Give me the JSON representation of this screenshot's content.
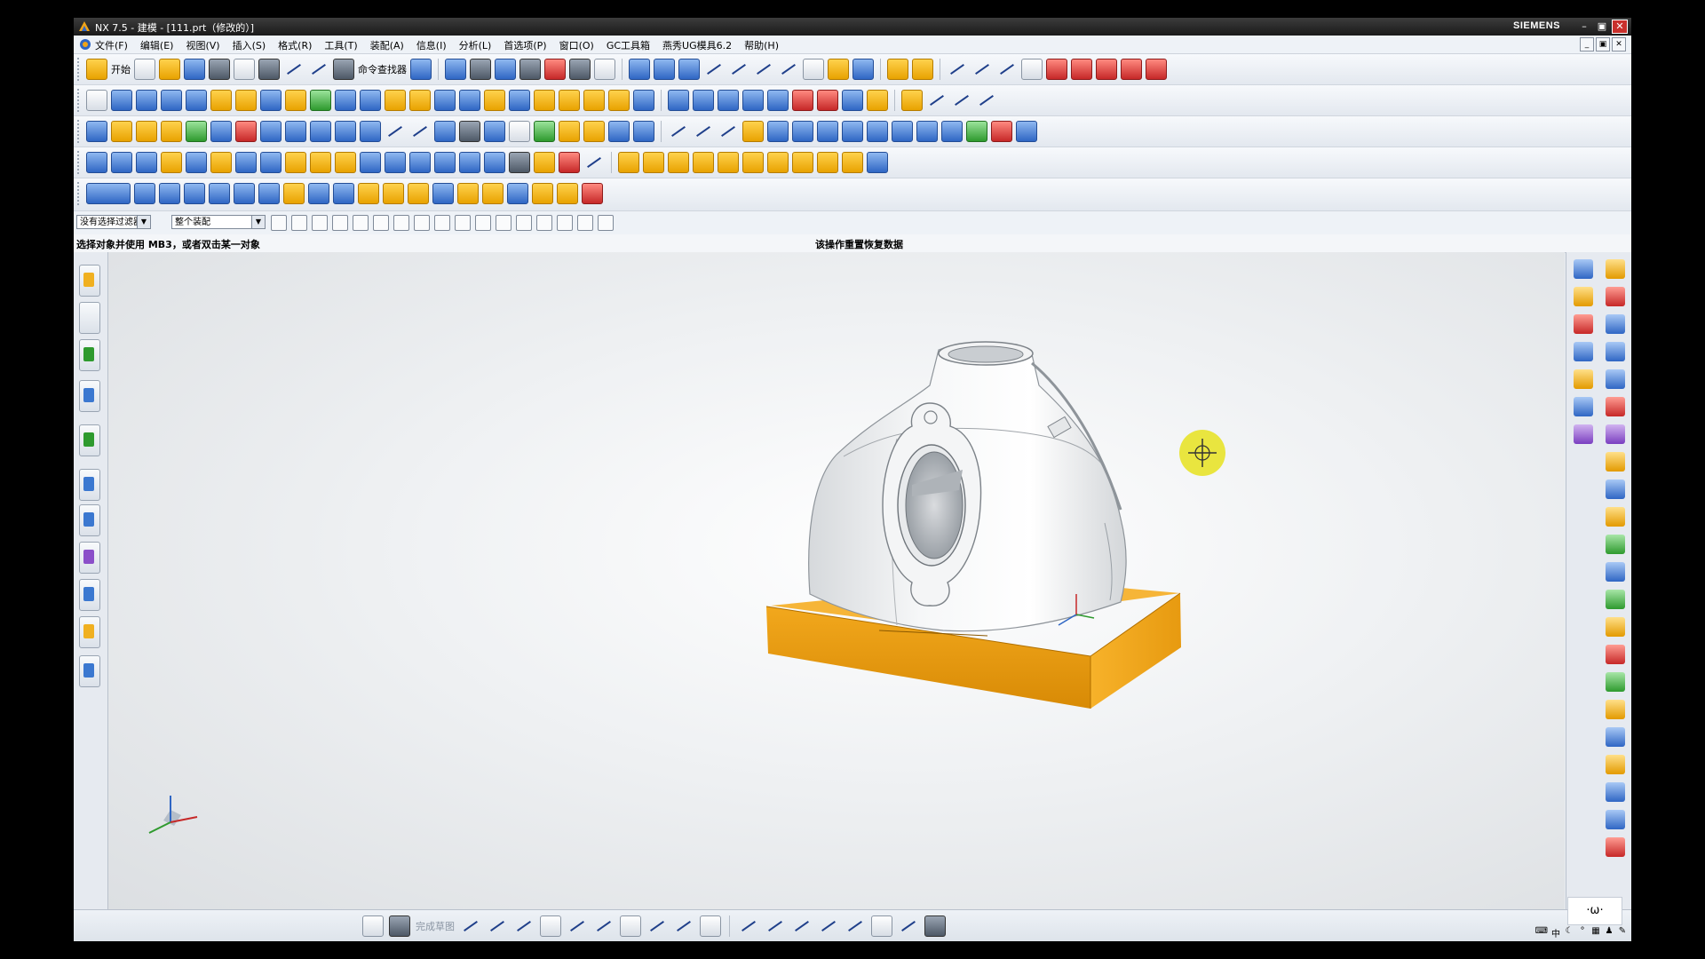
{
  "window": {
    "title": "NX 7.5 - 建模 - [111.prt（修改的）]",
    "brand": "SIEMENS",
    "minimize_label": "–",
    "restore_label": "▣",
    "close_label": "✕"
  },
  "menu": {
    "items": [
      "文件(F)",
      "编辑(E)",
      "视图(V)",
      "插入(S)",
      "格式(R)",
      "工具(T)",
      "装配(A)",
      "信息(I)",
      "分析(L)",
      "首选项(P)",
      "窗口(O)",
      "GC工具箱",
      "燕秀UG模具6.2",
      "帮助(H)"
    ],
    "doc_minimize": "_",
    "doc_restore": "▣",
    "doc_close": "✕"
  },
  "toolbar": {
    "start_label": "开始",
    "command_finder_label": "命令查找器"
  },
  "filterbar": {
    "type_filter": "没有选择过滤器",
    "scope_filter": "整个装配"
  },
  "status": {
    "prompt": "选择对象并使用 MB3，或者双击某一对象",
    "message": "该操作重置恢复数据"
  },
  "sketch_toolbar": {
    "finish_label": "完成草图"
  },
  "tray": {
    "ime_label": "中",
    "ime_face": "·ω·"
  },
  "colors": {
    "base_plate": "#f0a418",
    "part_body": "#e8eaec",
    "cursor_highlight": "#e6e21e"
  }
}
